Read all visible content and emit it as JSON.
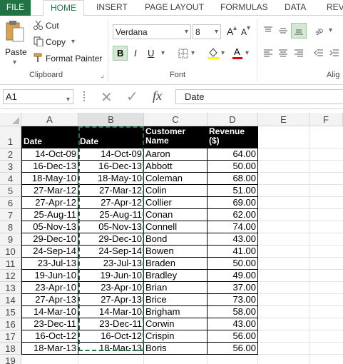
{
  "ribbon_tabs": [
    "FILE",
    "HOME",
    "INSERT",
    "PAGE LAYOUT",
    "FORMULAS",
    "DATA",
    "REV"
  ],
  "clipboard": {
    "paste": "Paste",
    "cut": "Cut",
    "copy": "Copy",
    "format_painter": "Format Painter",
    "group_label": "Clipboard"
  },
  "font": {
    "family": "Verdana",
    "size": "8",
    "bold": "B",
    "italic": "I",
    "underline": "U",
    "grow": "A",
    "shrink": "A",
    "font_color": "A",
    "group_label": "Font"
  },
  "alignment": {
    "group_label": "Alig"
  },
  "formula_bar": {
    "name_box": "A1",
    "fx": "fx",
    "content": "Date"
  },
  "columns": [
    "A",
    "B",
    "C",
    "D",
    "E",
    "F"
  ],
  "row_numbers": [
    "1",
    "2",
    "3",
    "4",
    "5",
    "6",
    "7",
    "8",
    "9",
    "10",
    "11",
    "12",
    "13",
    "14",
    "15",
    "16",
    "17",
    "18",
    "19"
  ],
  "headers": [
    "Date",
    "Date",
    "Customer Name",
    "Revenue ($)"
  ],
  "rows": [
    [
      "14-Oct-09",
      "14-Oct-09",
      "Aaron",
      "64.00"
    ],
    [
      "16-Dec-13",
      "16-Dec-13",
      "Abbott",
      "50.00"
    ],
    [
      "18-May-10",
      "18-May-10",
      "Coleman",
      "68.00"
    ],
    [
      "27-Mar-12",
      "27-Mar-12",
      "Colin",
      "51.00"
    ],
    [
      "27-Apr-12",
      "27-Apr-12",
      "Collier",
      "69.00"
    ],
    [
      "25-Aug-11",
      "25-Aug-11",
      "Conan",
      "62.00"
    ],
    [
      "05-Nov-13",
      "05-Nov-13",
      "Connell",
      "74.00"
    ],
    [
      "29-Dec-10",
      "29-Dec-10",
      "Bond",
      "43.00"
    ],
    [
      "24-Sep-14",
      "24-Sep-14",
      "Bowen",
      "41.00"
    ],
    [
      "23-Jul-13",
      "23-Jul-13",
      "Braden",
      "50.00"
    ],
    [
      "19-Jun-10",
      "19-Jun-10",
      "Bradley",
      "49.00"
    ],
    [
      "23-Apr-10",
      "23-Apr-10",
      "Brian",
      "37.00"
    ],
    [
      "27-Apr-13",
      "27-Apr-13",
      "Brice",
      "73.00"
    ],
    [
      "14-Mar-10",
      "14-Mar-10",
      "Brigham",
      "58.00"
    ],
    [
      "23-Dec-11",
      "23-Dec-11",
      "Corwin",
      "43.00"
    ],
    [
      "16-Oct-12",
      "16-Oct-12",
      "Crispin",
      "56.00"
    ],
    [
      "18-Mar-13",
      "18-Mar-13",
      "Boris",
      "56.00"
    ]
  ],
  "colors": {
    "accent": "#217346",
    "header_fill": "#000000",
    "copy_marquee": "#217346"
  }
}
